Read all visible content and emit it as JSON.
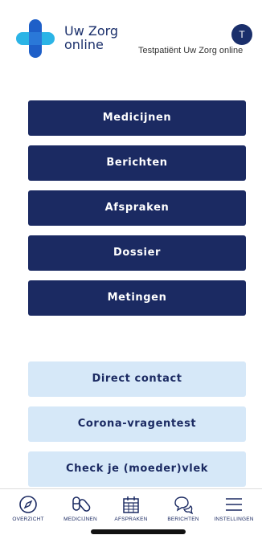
{
  "header": {
    "brand_line1": "Uw Zorg",
    "brand_line2": "online",
    "avatar_initial": "T",
    "username": "Testpatiënt Uw Zorg online"
  },
  "menu": {
    "items": [
      {
        "label": "Medicijnen"
      },
      {
        "label": "Berichten"
      },
      {
        "label": "Afspraken"
      },
      {
        "label": "Dossier"
      },
      {
        "label": "Metingen"
      }
    ]
  },
  "secondary": {
    "items": [
      {
        "label": "Direct contact"
      },
      {
        "label": "Corona-vragentest"
      },
      {
        "label": "Check je (moeder)vlek"
      }
    ]
  },
  "nav": {
    "items": [
      {
        "label": "OVERZICHT",
        "icon": "compass-icon"
      },
      {
        "label": "MEDICIJNEN",
        "icon": "pills-icon"
      },
      {
        "label": "AFSPRAKEN",
        "icon": "calendar-icon"
      },
      {
        "label": "BERICHTEN",
        "icon": "chat-icon"
      },
      {
        "label": "INSTELLINGEN",
        "icon": "menu-icon"
      }
    ]
  },
  "colors": {
    "primary": "#1b2a62",
    "secondary_bg": "#d6e8f8",
    "logo_blue": "#1e5fc8",
    "logo_cyan": "#2bb4e6"
  }
}
